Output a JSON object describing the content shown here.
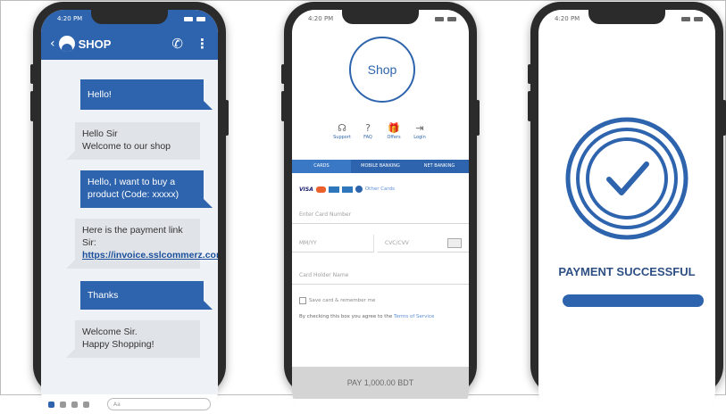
{
  "colors": {
    "accent": "#2e64ad",
    "bubble_in": "#e0e3e8",
    "pay_button": "#d4d4d4"
  },
  "status_bar": {
    "time": "4:20 PM"
  },
  "chat": {
    "header_title": "SHOP",
    "messages": [
      {
        "from": "me",
        "text": "Hello!"
      },
      {
        "from": "shop",
        "text": "Hello Sir\nWelcome to our shop"
      },
      {
        "from": "me",
        "text": "Hello, I want to buy a product (Code: xxxxx)"
      },
      {
        "from": "shop",
        "text": "Here is the payment link Sir: ",
        "link": "https://invoice.sslcommerz.com"
      },
      {
        "from": "me",
        "text": "Thanks"
      },
      {
        "from": "shop",
        "text": "Welcome Sir.\nHappy Shopping!"
      }
    ],
    "input_placeholder": "Aa"
  },
  "payment": {
    "logo_text": "Shop",
    "quick_links": [
      {
        "icon": "support-icon",
        "label": "Support"
      },
      {
        "icon": "faq-icon",
        "label": "FAQ"
      },
      {
        "icon": "offers-icon",
        "label": "Offers"
      },
      {
        "icon": "login-icon",
        "label": "Login"
      }
    ],
    "tabs": [
      "CARDS",
      "MOBILE BANKING",
      "NET BANKING"
    ],
    "other_cards": "Other Cards",
    "card_number_placeholder": "Enter Card Number",
    "expiry_placeholder": "MM/YY",
    "cvc_placeholder": "CVC/CVV",
    "card_holder_placeholder": "Card Holder Name",
    "save_card_label": "Save card & remember me",
    "agree_text": "By checking this box you agree to the ",
    "agree_link": "Terms of Service",
    "pay_button": "PAY 1,000.00 BDT"
  },
  "success": {
    "title": "PAYMENT SUCCESSFUL"
  }
}
